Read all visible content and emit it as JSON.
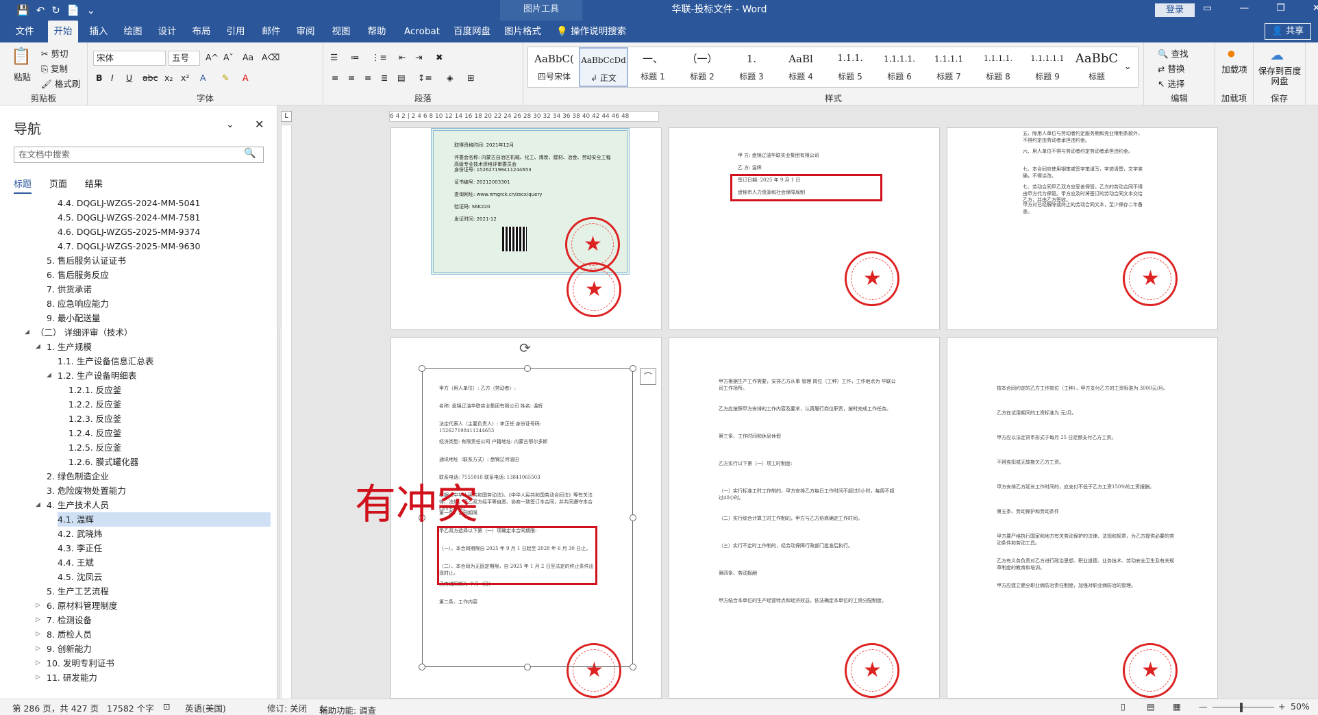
{
  "window": {
    "context_tool": "图片工具",
    "title": "华联-投标文件 - Word",
    "login": "登录",
    "share": "共享"
  },
  "tabs": [
    "文件",
    "开始",
    "插入",
    "绘图",
    "设计",
    "布局",
    "引用",
    "邮件",
    "审阅",
    "视图",
    "帮助",
    "Acrobat",
    "百度网盘",
    "图片格式",
    "操作说明搜索"
  ],
  "ribbon": {
    "clipboard": {
      "paste": "粘贴",
      "cut": "剪切",
      "copy": "复制",
      "format_painter": "格式刷",
      "label": "剪贴板"
    },
    "font": {
      "name": "宋体",
      "size": "五号",
      "label": "字体"
    },
    "paragraph": {
      "label": "段落"
    },
    "styles": {
      "label": "样式",
      "items": [
        {
          "sample": "AaBbC(",
          "name": "四号宋体"
        },
        {
          "sample": "AaBbCcDd",
          "name": "↲ 正文"
        },
        {
          "sample": "一、",
          "name": "标题 1"
        },
        {
          "sample": "（一）",
          "name": "标题 2"
        },
        {
          "sample": "1.",
          "name": "标题 3"
        },
        {
          "sample": "AaBl",
          "name": "标题 4"
        },
        {
          "sample": "1.1.1.",
          "name": "标题 5"
        },
        {
          "sample": "1.1.1.1.",
          "name": "标题 6"
        },
        {
          "sample": "1.1.1.1",
          "name": "标题 7"
        },
        {
          "sample": "1.1.1.1.",
          "name": "标题 8"
        },
        {
          "sample": "1.1.1.1.1",
          "name": "标题 9"
        },
        {
          "sample": "AaBbC",
          "name": "标题"
        }
      ]
    },
    "editing": {
      "find": "查找",
      "replace": "替换",
      "select": "选择",
      "label": "编辑"
    },
    "addins": {
      "add": "加载项",
      "label": "加载项"
    },
    "save": {
      "btn": "保存到百度网盘",
      "label": "保存"
    }
  },
  "nav": {
    "title": "导航",
    "search_placeholder": "在文档中搜索",
    "tabs": [
      "标题",
      "页面",
      "结果"
    ],
    "items": [
      {
        "text": "4.4. DQGLJ-WZGS-2024-MM-5041",
        "indent": 4
      },
      {
        "text": "4.5. DQGLJ-WZGS-2024-MM-7581",
        "indent": 4
      },
      {
        "text": "4.6. DQGLJ-WZGS-2025-MM-9374",
        "indent": 4
      },
      {
        "text": "4.7. DQGLJ-WZGS-2025-MM-9630",
        "indent": 4
      },
      {
        "text": "5. 售后服务认证证书",
        "indent": 3
      },
      {
        "text": "6. 售后服务反应",
        "indent": 3
      },
      {
        "text": "7. 供货承诺",
        "indent": 3
      },
      {
        "text": "8. 应急响应能力",
        "indent": 3
      },
      {
        "text": "9. 最小配送量",
        "indent": 3
      },
      {
        "text": "（二） 详细评审（技术）",
        "indent": 2,
        "toggle": "◢"
      },
      {
        "text": "1. 生产规模",
        "indent": 3,
        "toggle": "◢"
      },
      {
        "text": "1.1. 生产设备信息汇总表",
        "indent": 4
      },
      {
        "text": "1.2. 生产设备明细表",
        "indent": 4,
        "toggle": "◢"
      },
      {
        "text": "1.2.1. 反应釜",
        "indent": 5
      },
      {
        "text": "1.2.2. 反应釜",
        "indent": 5
      },
      {
        "text": "1.2.3. 反应釜",
        "indent": 5
      },
      {
        "text": "1.2.4. 反应釜",
        "indent": 5
      },
      {
        "text": "1.2.5. 反应釜",
        "indent": 5
      },
      {
        "text": "1.2.6. 膜式罐化器",
        "indent": 5
      },
      {
        "text": "2. 绿色制造企业",
        "indent": 3
      },
      {
        "text": "3. 危险废物处置能力",
        "indent": 3
      },
      {
        "text": "4. 生产技术人员",
        "indent": 3,
        "toggle": "◢"
      },
      {
        "text": "4.1. 温辉",
        "indent": 4,
        "selected": true
      },
      {
        "text": "4.2. 武晓炜",
        "indent": 4
      },
      {
        "text": "4.3. 李正任",
        "indent": 4
      },
      {
        "text": "4.4. 王斌",
        "indent": 4
      },
      {
        "text": "4.5. 沈凤云",
        "indent": 4
      },
      {
        "text": "5. 生产工艺流程",
        "indent": 3
      },
      {
        "text": "6. 原材料管理制度",
        "indent": 3,
        "toggle": "▷"
      },
      {
        "text": "7. 检测设备",
        "indent": 3,
        "toggle": "▷"
      },
      {
        "text": "8. 质检人员",
        "indent": 3,
        "toggle": "▷"
      },
      {
        "text": "9. 创新能力",
        "indent": 3,
        "toggle": "▷"
      },
      {
        "text": "10. 发明专利证书",
        "indent": 3,
        "toggle": "▷"
      },
      {
        "text": "11. 研发能力",
        "indent": 3,
        "toggle": "▷"
      }
    ]
  },
  "ruler": "6 4 2 | 2 4 6 8 10 12 14 16 18 20 22 24 26 28 30 32 34 36 38 40 42 44 46 48",
  "pages": {
    "cert_lines": [
      "取得资格时间: 2021年12月",
      "评委会名称: 内蒙古自治区机械、化工、煤炭、建材、冶金、劳动安全工程高级专业技术资格评审委员会",
      "身份证号: 152627198411244653",
      "证书编号: 20212003301",
      "查询网址: www.nmgrck.cn/zscx/query",
      "验证码: S6K220",
      "发证时间: 2021-12"
    ],
    "p2_lines": [
      "甲 方: 盘锦辽油华联实业集团有限公司",
      "乙 方: 温辉",
      "签订日期: 2025 年 9 月 1 日",
      "盘锦市人力资源和社会保障局制"
    ],
    "p3_lines": [
      "五、除用人单位与劳动者约定服务期和竞业限制条款外，不得约定由劳动者承担违约金。",
      "六、用人单位不得与劳动者约定劳动者承担违约金。",
      "七、本合同应使用钢笔或签字笔填写，字迹清楚，文字准确，不得涂改。",
      "七、劳动合同甲乙双方应妥善保管。乙方的劳动合同不得由甲方代为保管。甲方应及时将签订的劳动合同文本交给乙方，并由乙方签收。",
      "甲方对已经解除或终止的劳动合同文本，至少保存二年备查。"
    ],
    "p4_lines": [
      "甲方（用人单位）: 乙方（劳动者）:",
      "名称: 盘锦辽油华联实业集团有限公司 姓名: 温辉",
      "法定代表人（主要负责人）: 李正任 身份证号码: 152627198411244653",
      "经济类型: 有限责任公司 户籍地址: 内蒙古鄂尔多斯",
      "通讯地址（联系方式）: 盘锦辽河油田",
      "联系电话: 7555018 联系电话: 13841065503",
      "根据《中华人民共和国劳动法》、《中华人民共和国劳动合同法》等有关法律、法规，甲乙双方经平等自愿、协商一致签订本合同，并共同遵守本合同所列条款。",
      "第一条、合同期限",
      "甲乙双方选择以下第（一）项确定本合同期限:",
      "（一）、本合同期限自 2025 年 9 月 1 日起至 2028 年 6 月 30 日止。",
      "（二）、本合同为无固定期限，自 2025 年 1 月 2 日至法定的终止条件出现时止。",
      "乙方试用期为 个月（日）",
      "第二条、工作内容"
    ],
    "p5_lines": [
      "甲方根据生产工作需要，安排乙方从事 管理 岗位（工种）工作，工作地点为 华联公司工作场所。",
      "乙方应按照甲方安排的工作内容及要求，认真履行岗位职责，按时完成工作任务。",
      "第三条、工作时间和休息休假",
      "乙方实行以下第（一）项工时制度:",
      "（一）实行标准工时工作制的，甲方安排乙方每日工作时间不超过8小时，每周不超过40小时。",
      "（二）实行综合计算工时工作制的，甲方与乙方协商确定工作时间。",
      "（三）实行不定时工作制的，经劳动保障行政部门批准后执行。",
      "第四条、劳动报酬",
      "甲方结合本单位的生产经营特点和经济效益，依法确定本单位的工资分配制度。"
    ],
    "p6_lines": [
      "按本合同约定的乙方工作岗位（工种），甲方支付乙方的工资标准为 3000元/月。",
      "乙方在试用期间的工资标准为 元/月。",
      "甲方应以法定货币形式于每月 25 日足额支付乙方工资。",
      "不得克扣或无故拖欠乙方工资。",
      "甲方安排乙方延长工作时间的，应支付不低于乙方工资150%的工资报酬。",
      "第五条、劳动保护和劳动条件",
      "甲方要严格执行国家和地方有关劳动保护的法律、法规和规章，为乙方提供必要的劳动条件和劳动工具。",
      "乙方有义务负责对乙方进行政治思想、职业道德、业务技术、劳动安全卫生及有关规章制度的教育和培训。",
      "甲方应建立健全职业病防治责任制度，加强对职业病防治的管理。"
    ],
    "conflict_text": "有冲突"
  },
  "status": {
    "page": "第 286 页，共 427 页",
    "words": "17582 个字",
    "lang": "英语(美国)",
    "track": "修订: 关闭",
    "access": "辅助功能: 调查",
    "zoom": "50%"
  }
}
